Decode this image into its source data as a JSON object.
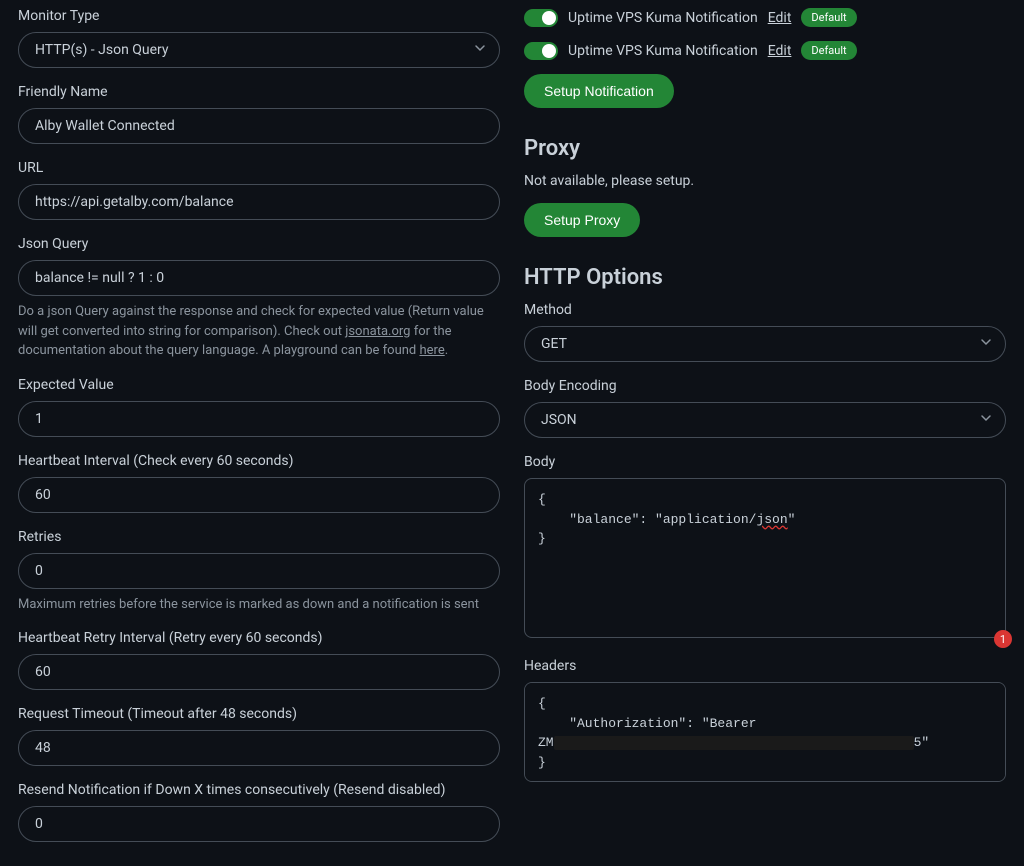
{
  "left": {
    "monitor_type": {
      "label": "Monitor Type",
      "value": "HTTP(s) - Json Query"
    },
    "friendly_name": {
      "label": "Friendly Name",
      "value": "Alby Wallet Connected"
    },
    "url": {
      "label": "URL",
      "value": "https://api.getalby.com/balance"
    },
    "json_query": {
      "label": "Json Query",
      "value": "balance != null ? 1 : 0",
      "help_pre": "Do a json Query against the response and check for expected value (Return value will get converted into string for comparison). Check out ",
      "help_link1": "jsonata.org",
      "help_mid": " for the documentation about the query language. A playground can be found ",
      "help_link2": "here",
      "help_post": "."
    },
    "expected_value": {
      "label": "Expected Value",
      "value": "1"
    },
    "heartbeat_interval": {
      "label": "Heartbeat Interval (Check every 60 seconds)",
      "value": "60"
    },
    "retries": {
      "label": "Retries",
      "value": "0",
      "help": "Maximum retries before the service is marked as down and a notification is sent"
    },
    "retry_interval": {
      "label": "Heartbeat Retry Interval (Retry every 60 seconds)",
      "value": "60"
    },
    "request_timeout": {
      "label": "Request Timeout (Timeout after 48 seconds)",
      "value": "48"
    },
    "resend": {
      "label": "Resend Notification if Down X times consecutively (Resend disabled)",
      "value": "0"
    }
  },
  "right": {
    "notifications": [
      {
        "label": "Uptime VPS Kuma Notification",
        "edit": "Edit",
        "badge": "Default",
        "on": true
      },
      {
        "label": "Uptime VPS Kuma Notification",
        "edit": "Edit",
        "badge": "Default",
        "on": true
      }
    ],
    "setup_notification": "Setup Notification",
    "proxy": {
      "title": "Proxy",
      "status": "Not available, please setup.",
      "button": "Setup Proxy"
    },
    "http_options": {
      "title": "HTTP Options",
      "method": {
        "label": "Method",
        "value": "GET"
      },
      "body_encoding": {
        "label": "Body Encoding",
        "value": "JSON"
      },
      "body": {
        "label": "Body",
        "value": "{\n    \"balance\": \"application/json\"\n}",
        "error_count": "1"
      },
      "headers": {
        "label": "Headers",
        "value_visible_prefix": "{\n    \"Authorization\": \"Bearer\nZM",
        "value_visible_suffix": "5\"\n}",
        "value_full": "{\n    \"Authorization\": \"Bearer\nZM██████████████████████████████████████████████5\"\n}"
      }
    }
  }
}
